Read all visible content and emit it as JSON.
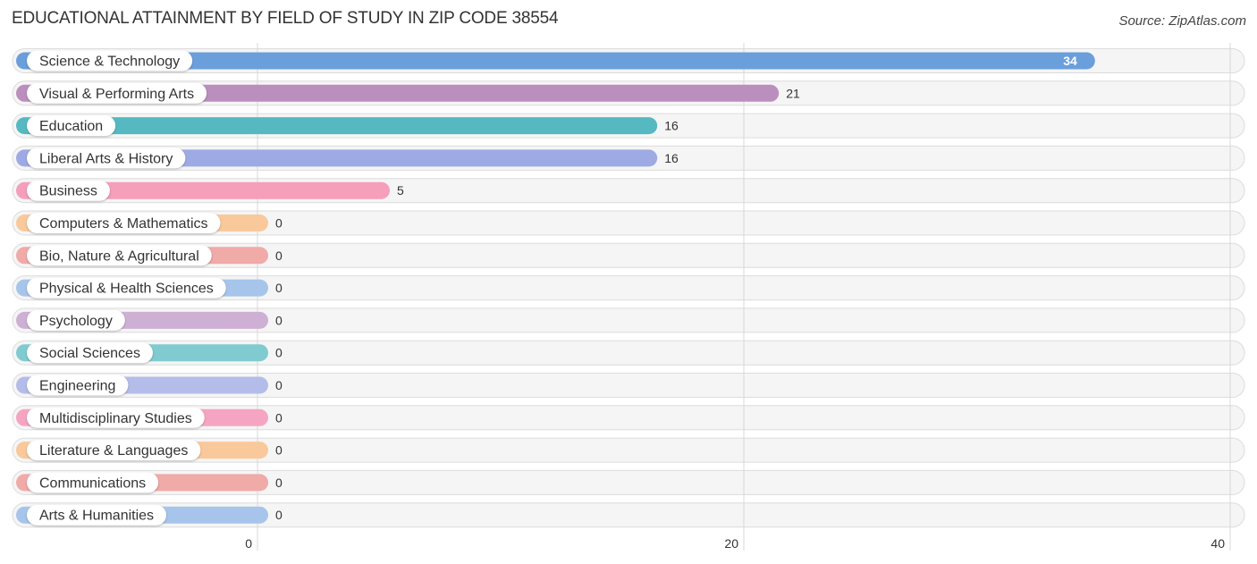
{
  "header": {
    "title": "EDUCATIONAL ATTAINMENT BY FIELD OF STUDY IN ZIP CODE 38554",
    "source": "Source: ZipAtlas.com"
  },
  "chart_data": {
    "type": "bar",
    "orientation": "horizontal",
    "title": "EDUCATIONAL ATTAINMENT BY FIELD OF STUDY IN ZIP CODE 38554",
    "xlabel": "",
    "ylabel": "",
    "xlim": [
      0,
      40
    ],
    "xticks": [
      0,
      20,
      40
    ],
    "xtick_labels": [
      "0",
      "20",
      "40"
    ],
    "grid": true,
    "categories": [
      "Science & Technology",
      "Visual & Performing Arts",
      "Education",
      "Liberal Arts & History",
      "Business",
      "Computers & Mathematics",
      "Bio, Nature & Agricultural",
      "Physical & Health Sciences",
      "Psychology",
      "Social Sciences",
      "Engineering",
      "Multidisciplinary Studies",
      "Literature & Languages",
      "Communications",
      "Arts & Humanities"
    ],
    "values": [
      34,
      21,
      16,
      16,
      5,
      0,
      0,
      0,
      0,
      0,
      0,
      0,
      0,
      0,
      0
    ],
    "value_labels": [
      "34",
      "21",
      "16",
      "16",
      "5",
      "0",
      "0",
      "0",
      "0",
      "0",
      "0",
      "0",
      "0",
      "0",
      "0"
    ],
    "colors": [
      "#6a9fdc",
      "#bb8fbd",
      "#56b9c2",
      "#9eaae4",
      "#f59fbb",
      "#f9c99b",
      "#f0aaa8",
      "#a7c5ea",
      "#cdb0d4",
      "#7fcbd0",
      "#b4bde9",
      "#f5a5c2",
      "#f9c99b",
      "#f0aaa8",
      "#a7c5ea"
    ]
  }
}
